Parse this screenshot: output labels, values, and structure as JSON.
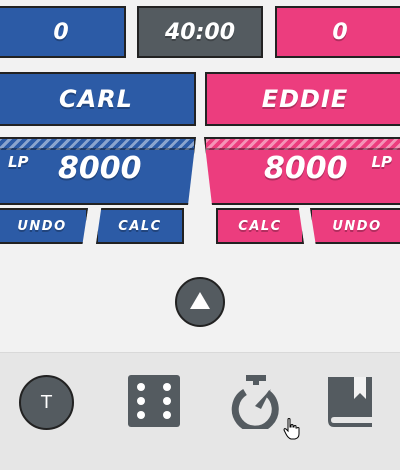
{
  "scoreboard": {
    "left_score": "0",
    "timer": "40:00",
    "right_score": "0"
  },
  "players": {
    "left": {
      "name": "CARL",
      "lp_label": "LP",
      "lp_value": "8000",
      "undo": "UNDO",
      "calc": "CALC"
    },
    "right": {
      "name": "EDDIE",
      "lp_label": "LP",
      "lp_value": "8000",
      "calc": "CALC",
      "undo": "UNDO"
    }
  },
  "toolbar": {
    "avatar_letter": "T",
    "icons": [
      "dice-icon",
      "stopwatch-icon",
      "bookmark-book-icon"
    ]
  },
  "colors": {
    "player1": "#2c5ba6",
    "player2": "#ec3d7e",
    "neutral": "#545b60",
    "background": "#f2f2f2"
  }
}
